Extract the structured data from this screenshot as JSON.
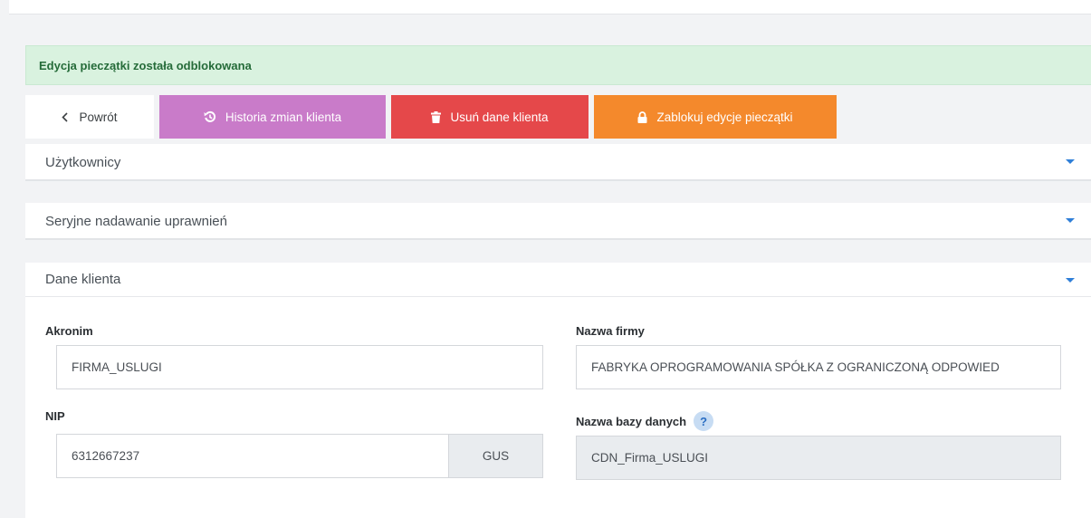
{
  "alert": {
    "message": "Edycja pieczątki została odblokowana"
  },
  "toolbar": {
    "back_label": "Powrót",
    "history_label": "Historia zmian klienta",
    "delete_label": "Usuń dane klienta",
    "lock_label": "Zablokuj edycje pieczątki"
  },
  "panels": {
    "users": {
      "title": "Użytkownicy"
    },
    "permissions": {
      "title": "Seryjne nadawanie uprawnień"
    },
    "client": {
      "title": "Dane klienta",
      "akronim_label": "Akronim",
      "akronim_value": "FIRMA_USLUGI",
      "company_label": "Nazwa firmy",
      "company_value": "FABRYKA OPROGRAMOWANIA SPÓŁKA Z OGRANICZONĄ ODPOWIED",
      "nip_label": "NIP",
      "nip_value": "6312667237",
      "gus_label": "GUS",
      "db_label": "Nazwa bazy danych",
      "db_help": "?",
      "db_value": "CDN_Firma_USLUGI"
    }
  },
  "colors": {
    "alert_bg": "#d9f2df",
    "history_btn": "#c97bc9",
    "delete_btn": "#e5484a",
    "lock_btn": "#f4892c",
    "caret": "#2f7fd8"
  },
  "icons": [
    "chevron-left-icon",
    "history-icon",
    "trash-icon",
    "lock-icon",
    "caret-down-icon",
    "help-icon"
  ]
}
